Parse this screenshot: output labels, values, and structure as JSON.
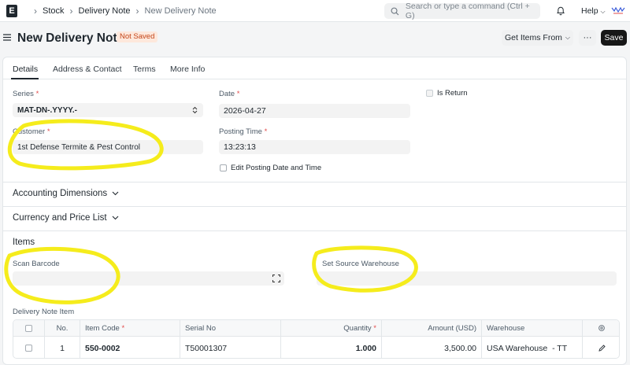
{
  "breadcrumbs": [
    "Stock",
    "Delivery Note",
    "New Delivery Note"
  ],
  "search": {
    "placeholder": "Search or type a command (Ctrl + G)"
  },
  "help_label": "Help",
  "page": {
    "title": "New Delivery Note",
    "status": "Not Saved"
  },
  "actions": {
    "get_items": "Get Items From",
    "more": "···",
    "save": "Save"
  },
  "tabs": [
    {
      "label": "Details",
      "active": true
    },
    {
      "label": "Address & Contact"
    },
    {
      "label": "Terms"
    },
    {
      "label": "More Info"
    }
  ],
  "fields": {
    "series": {
      "label": "Series",
      "value": "MAT-DN-.YYYY.-"
    },
    "customer": {
      "label": "Customer",
      "value": "1st Defense Termite & Pest Control"
    },
    "date": {
      "label": "Date",
      "value": "2026-04-27"
    },
    "posting_time": {
      "label": "Posting Time",
      "value": "13:23:13"
    },
    "edit_posting": {
      "label": "Edit Posting Date and Time"
    },
    "is_return": {
      "label": "Is Return"
    }
  },
  "sections": {
    "accounting": "Accounting Dimensions",
    "currency": "Currency and Price List",
    "items": "Items"
  },
  "items": {
    "scan_barcode_label": "Scan Barcode",
    "source_warehouse_label": "Set Source Warehouse",
    "table_title": "Delivery Note Item",
    "columns": {
      "no": "No.",
      "item_code": "Item Code",
      "serial_no": "Serial No",
      "quantity": "Quantity",
      "amount": "Amount (USD)",
      "warehouse": "Warehouse"
    },
    "rows": [
      {
        "no": "1",
        "item_code": "550-0002",
        "serial_no": "T50001307",
        "quantity": "1.000",
        "amount": "3,500.00",
        "warehouse": "USA Warehouse  - TT"
      }
    ]
  },
  "colors": {
    "annotation": "#f5ec1c",
    "save_bg": "#171717",
    "badge_bg": "#fde8dc",
    "badge_fg": "#c4461a"
  }
}
